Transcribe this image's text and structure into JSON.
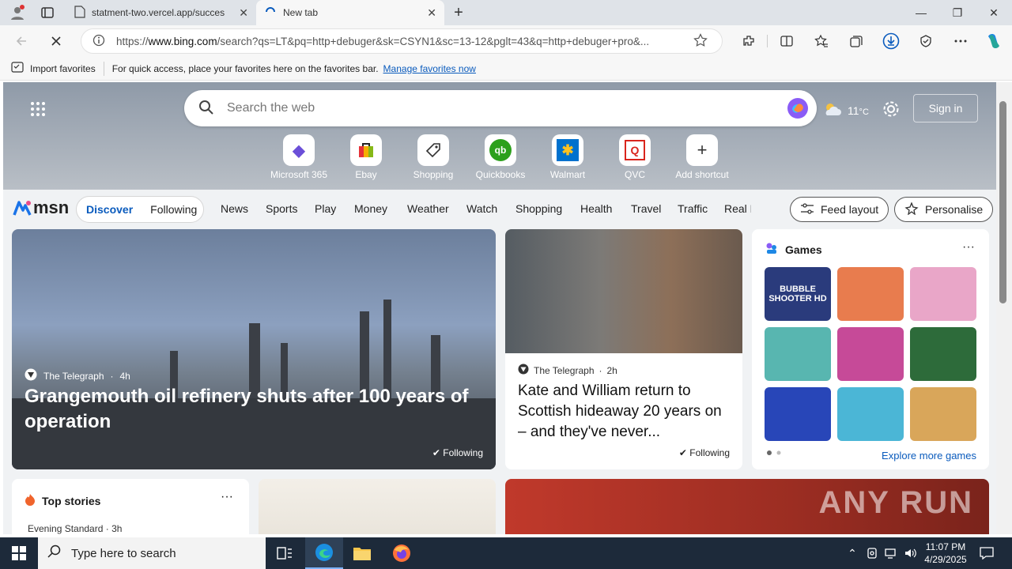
{
  "browser": {
    "tabs": [
      {
        "title": "statment-two.vercel.app/succes"
      },
      {
        "title": "New tab"
      }
    ],
    "new_tab_symbol": "+",
    "window_controls": {
      "minimize": "—",
      "restore": "❐",
      "close": "✕"
    },
    "url": {
      "prefix": "https://",
      "host": "www.bing.com",
      "path": "/search?qs=LT&pq=http+debuger&sk=CSYN1&sc=13-12&pglt=43&q=http+debuger+pro&..."
    }
  },
  "favorites_bar": {
    "import_label": "Import favorites",
    "message": "For quick access, place your favorites here on the favorites bar.",
    "manage_link": "Manage favorites now"
  },
  "newtab": {
    "search_placeholder": "Search the web",
    "weather_temp": "11",
    "weather_unit": "°C",
    "sign_in": "Sign in",
    "shortcuts": [
      {
        "label": "Microsoft 365",
        "glyph": "◆",
        "color": "#6b4fd8"
      },
      {
        "label": "Ebay",
        "glyph": "▣",
        "color": "#e53238"
      },
      {
        "label": "Shopping",
        "glyph": "⬠",
        "color": "#333333"
      },
      {
        "label": "Quickbooks",
        "glyph": "qb",
        "color": "#2ca01c"
      },
      {
        "label": "Walmart",
        "glyph": "✱",
        "color": "#ffc220"
      },
      {
        "label": "QVC",
        "glyph": "Q",
        "color": "#d9251d"
      },
      {
        "label": "Add shortcut",
        "glyph": "+",
        "color": "#333333"
      }
    ]
  },
  "msn": {
    "logo_text": "msn",
    "discover": "Discover",
    "following": "Following",
    "nav": [
      "News",
      "Sports",
      "Play",
      "Money",
      "Weather",
      "Watch",
      "Shopping",
      "Health",
      "Travel",
      "Traffic",
      "Real E"
    ],
    "feed_layout": "Feed layout",
    "personalise": "Personalise"
  },
  "stories": {
    "main": {
      "source": "The Telegraph",
      "age": "4h",
      "headline": "Grangemouth oil refinery shuts after 100 years of operation",
      "follow": "Following"
    },
    "second": {
      "source": "The Telegraph",
      "age": "2h",
      "headline": "Kate and William return to Scottish hideaway 20 years on – and they've never...",
      "follow": "Following"
    },
    "top_stories": {
      "title": "Top stories",
      "source": "Evening Standard",
      "age": "3h"
    }
  },
  "games": {
    "title": "Games",
    "explore": "Explore more games",
    "tiles": [
      {
        "name": "BUBBLE SHOOTER HD",
        "color": "#2a3b7c"
      },
      {
        "name": "",
        "color": "#e87c4e"
      },
      {
        "name": "",
        "color": "#e9a6c8"
      },
      {
        "name": "",
        "color": "#58b6b0"
      },
      {
        "name": "",
        "color": "#c64a98"
      },
      {
        "name": "",
        "color": "#2d6b3a"
      },
      {
        "name": "",
        "color": "#2846b8"
      },
      {
        "name": "",
        "color": "#4bb6d6"
      },
      {
        "name": "",
        "color": "#d9a65a"
      }
    ]
  },
  "watermark": "ANY RUN",
  "taskbar": {
    "search_placeholder": "Type here to search",
    "time": "11:07 PM",
    "date": "4/29/2025"
  },
  "colors": {
    "accent_blue": "#0a5bbd",
    "taskbar": "#1d2a3a"
  }
}
